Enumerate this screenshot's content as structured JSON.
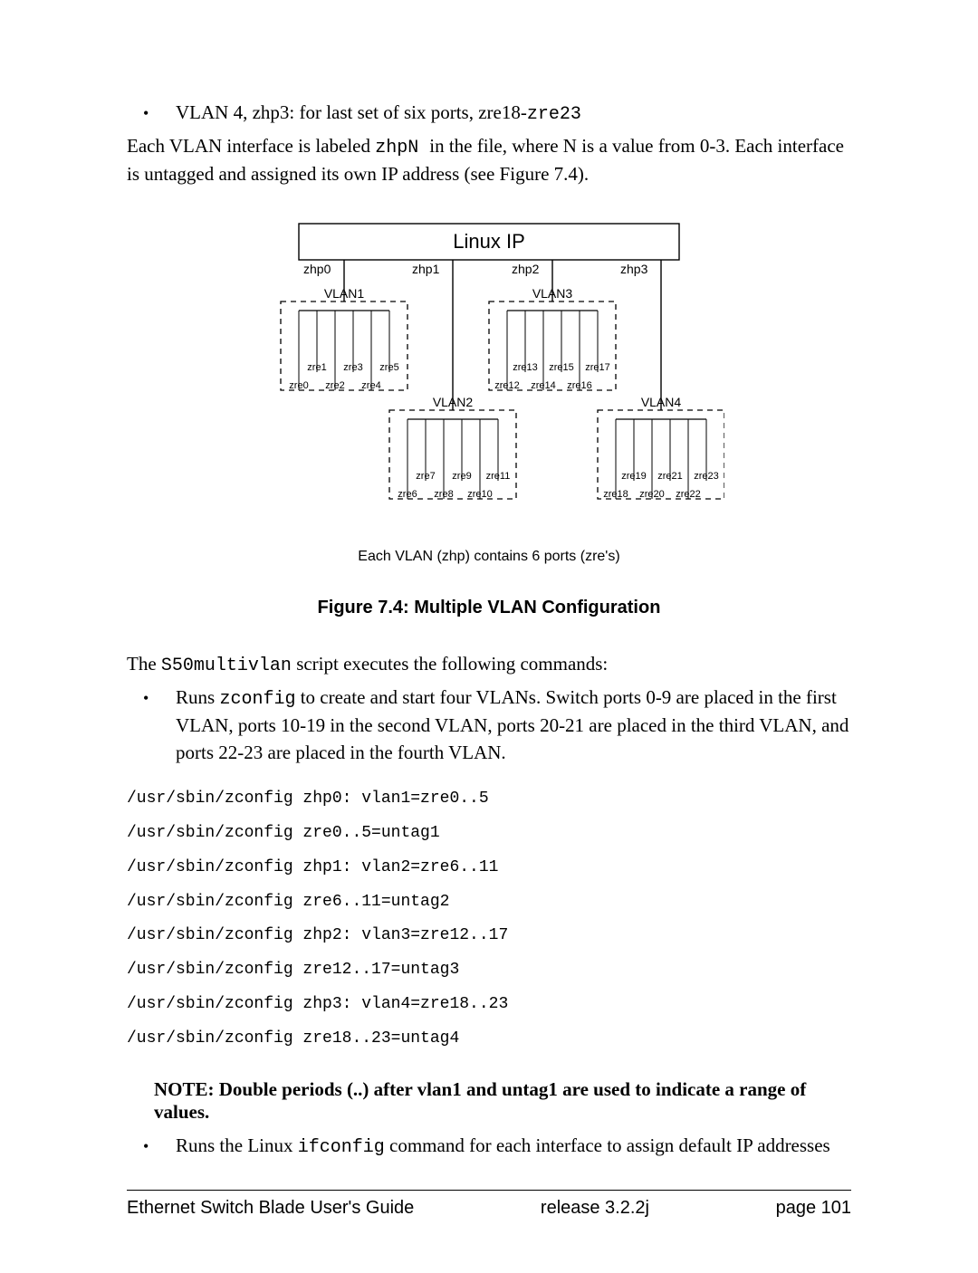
{
  "bullet1": {
    "prefix": "VLAN 4, zhp3: for last set of six ports, zre18-",
    "mono": "zre23"
  },
  "para1": {
    "t1": "Each VLAN interface is labeled ",
    "mono1": "zhpN ",
    "t2": " in the file, where N is a value from 0-3. Each interface is untagged and assigned its own IP address (see Figure 7.4)."
  },
  "diagram": {
    "top": "Linux IP",
    "zhp": [
      "zhp0",
      "zhp1",
      "zhp2",
      "zhp3"
    ],
    "vlan": [
      "VLAN1",
      "VLAN2",
      "VLAN3",
      "VLAN4"
    ],
    "zre_v1_top": [
      "zre1",
      "zre3",
      "zre5"
    ],
    "zre_v1_bot": [
      "zre0",
      "zre2",
      "zre4"
    ],
    "zre_v2_top": [
      "zre7",
      "zre9",
      "zre11"
    ],
    "zre_v2_bot": [
      "zre6",
      "zre8",
      "zre10"
    ],
    "zre_v3_top": [
      "zre13",
      "zre15",
      "zre17"
    ],
    "zre_v3_bot": [
      "zre12",
      "zre14",
      "zre16"
    ],
    "zre_v4_top": [
      "zre19",
      "zre21",
      "zre23"
    ],
    "zre_v4_bot": [
      "zre18",
      "zre20",
      "zre22"
    ],
    "caption": "Each VLAN (zhp) contains 6 ports (zre's)"
  },
  "figtitle": "Figure 7.4: Multiple VLAN Configuration",
  "para2": {
    "t1": "The ",
    "mono1": "S50multivlan",
    "t2": " script executes the following commands:"
  },
  "bullet2": {
    "t1": "Runs ",
    "mono1": "zconfig",
    "t2": " to create and start four VLANs.  Switch ports 0-9 are placed in the first VLAN, ports 10-19 in the second VLAN, ports 20-21 are placed in the third VLAN, and ports 22-23 are placed in the fourth VLAN."
  },
  "commands": [
    "/usr/sbin/zconfig zhp0: vlan1=zre0..5",
    "/usr/sbin/zconfig zre0..5=untag1",
    "/usr/sbin/zconfig zhp1: vlan2=zre6..11",
    "/usr/sbin/zconfig zre6..11=untag2",
    "/usr/sbin/zconfig zhp2: vlan3=zre12..17",
    "/usr/sbin/zconfig zre12..17=untag3",
    "/usr/sbin/zconfig zhp3: vlan4=zre18..23",
    "/usr/sbin/zconfig zre18..23=untag4"
  ],
  "note": "NOTE: Double periods (..) after vlan1 and untag1 are used to indicate a range of values.",
  "bullet3": {
    "t1": "Runs the Linux ",
    "mono1": "ifconfig",
    "t2": " command for each interface to assign default IP addresses"
  },
  "footer": {
    "left": "Ethernet Switch Blade User's Guide",
    "mid": "release  3.2.2j",
    "right": "page 101"
  }
}
